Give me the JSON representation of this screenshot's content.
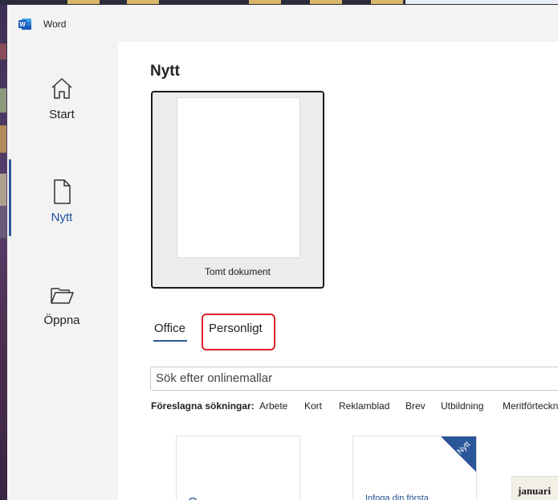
{
  "app": {
    "title": "Word"
  },
  "nav": {
    "items": [
      {
        "label": "Start",
        "icon": "home-icon"
      },
      {
        "label": "Nytt",
        "icon": "new-document-icon",
        "active": true
      },
      {
        "label": "Öppna",
        "icon": "folder-open-icon"
      }
    ]
  },
  "main": {
    "title": "Nytt",
    "blank_template": {
      "label": "Tomt dokument"
    },
    "tabs": [
      {
        "label": "Office",
        "selected": true
      },
      {
        "label": "Personligt",
        "selected": false
      }
    ],
    "search": {
      "placeholder": "Sök efter onlinemallar"
    },
    "suggested": {
      "label": "Föreslagna sökningar:",
      "items": [
        "Arbete",
        "Kort",
        "Reklamblad",
        "Brev",
        "Utbildning",
        "Meritförteckn"
      ]
    },
    "templates": [
      {
        "caption": "C"
      },
      {
        "caption": "Infoga din första",
        "badge": "Nytt"
      },
      {
        "caption": "januari"
      }
    ]
  },
  "colors": {
    "accent": "#2b579a",
    "active_nav_text": "#1c4f9c",
    "highlight": "#e0202a"
  }
}
